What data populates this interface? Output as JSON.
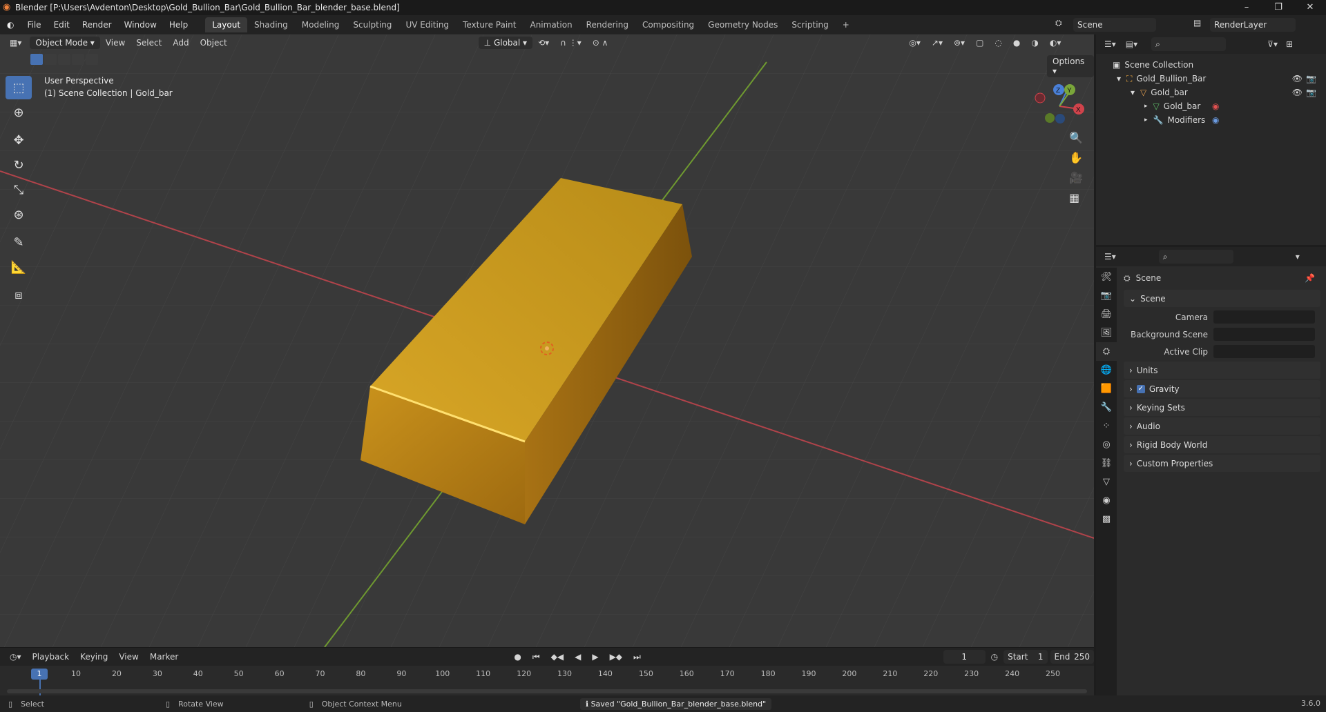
{
  "window": {
    "title": "Blender [P:\\Users\\Avdenton\\Desktop\\Gold_Bullion_Bar\\Gold_Bullion_Bar_blender_base.blend]",
    "minimize": "–",
    "maximize": "❐",
    "close": "✕"
  },
  "menu": [
    "File",
    "Edit",
    "Render",
    "Window",
    "Help"
  ],
  "workspaces": [
    "Layout",
    "Shading",
    "Modeling",
    "Sculpting",
    "UV Editing",
    "Texture Paint",
    "Animation",
    "Rendering",
    "Compositing",
    "Geometry Nodes",
    "Scripting",
    "+"
  ],
  "scene_field": "Scene",
  "view_layer_field": "RenderLayer",
  "viewport": {
    "mode": "Object Mode",
    "menus": [
      "View",
      "Select",
      "Add",
      "Object"
    ],
    "orientation": "Global",
    "options": "Options",
    "overlay_line1": "User Perspective",
    "overlay_line2": "(1) Scene Collection | Gold_bar",
    "gizmo": {
      "x": "X",
      "y": "Y",
      "z": "Z"
    }
  },
  "timeline": {
    "menus": [
      "Playback",
      "Keying",
      "View",
      "Marker"
    ],
    "current_frame": "1",
    "start_label": "Start",
    "start": "1",
    "end_label": "End",
    "end": "250",
    "ticks": [
      "1",
      "10",
      "20",
      "30",
      "40",
      "50",
      "60",
      "70",
      "80",
      "90",
      "100",
      "110",
      "120",
      "130",
      "140",
      "150",
      "160",
      "170",
      "180",
      "190",
      "200",
      "210",
      "220",
      "230",
      "240",
      "250"
    ]
  },
  "status": {
    "select": "Select",
    "rotate": "Rotate View",
    "context": "Object Context Menu",
    "message": "Saved \"Gold_Bullion_Bar_blender_base.blend\"",
    "version": "3.6.0"
  },
  "outliner": {
    "root": "Scene Collection",
    "items": [
      {
        "label": "Gold_Bullion_Bar",
        "level": 1
      },
      {
        "label": "Gold_bar",
        "level": 2
      },
      {
        "label": "Gold_bar",
        "level": 3
      },
      {
        "label": "Modifiers",
        "level": 3
      }
    ]
  },
  "properties": {
    "header": "Scene",
    "section": "Scene",
    "fields": [
      "Camera",
      "Background Scene",
      "Active Clip"
    ],
    "panels": [
      "Units",
      "Gravity",
      "Keying Sets",
      "Audio",
      "Rigid Body World",
      "Custom Properties"
    ]
  },
  "colors": {
    "accent": "#4772b3",
    "gold": "#c9a227",
    "x_axis": "#d0434b",
    "y_axis": "#7aa63a"
  }
}
